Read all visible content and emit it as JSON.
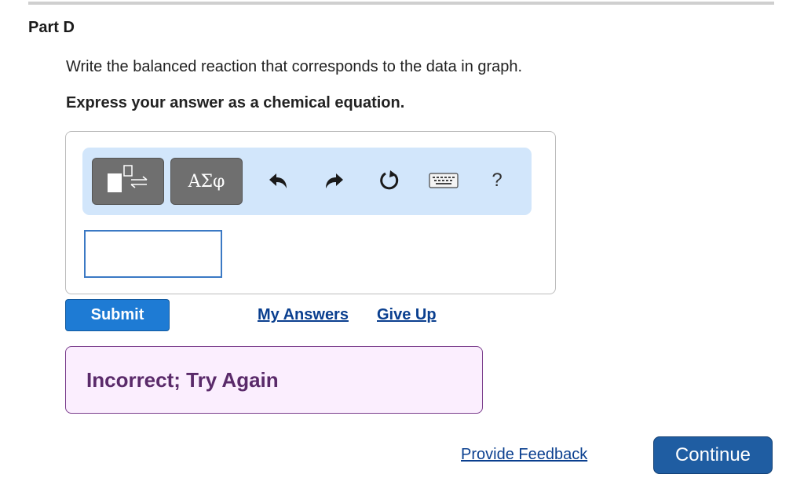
{
  "part": {
    "title": "Part D"
  },
  "question": {
    "prompt": "Write the balanced reaction that corresponds to the data in graph.",
    "instruction": "Express your answer as a chemical equation."
  },
  "toolbar": {
    "templates_icon": "template-arrow-icon",
    "symbols_label": "ΑΣφ",
    "undo_icon": "undo-icon",
    "redo_icon": "redo-icon",
    "reset_icon": "reset-icon",
    "keyboard_icon": "keyboard-icon",
    "help_label": "?"
  },
  "answer": {
    "value": ""
  },
  "actions": {
    "submit_label": "Submit",
    "my_answers_label": "My Answers",
    "give_up_label": "Give Up"
  },
  "feedback": {
    "message": "Incorrect; Try Again"
  },
  "footer": {
    "provide_feedback_label": "Provide Feedback",
    "continue_label": "Continue"
  },
  "colors": {
    "toolbar_bg": "#d2e6fb",
    "submit_bg": "#1e7bd4",
    "continue_bg": "#1f5da2",
    "feedback_bg": "#fbeefe",
    "feedback_border": "#7a3d8c",
    "link": "#0a3f8f"
  }
}
